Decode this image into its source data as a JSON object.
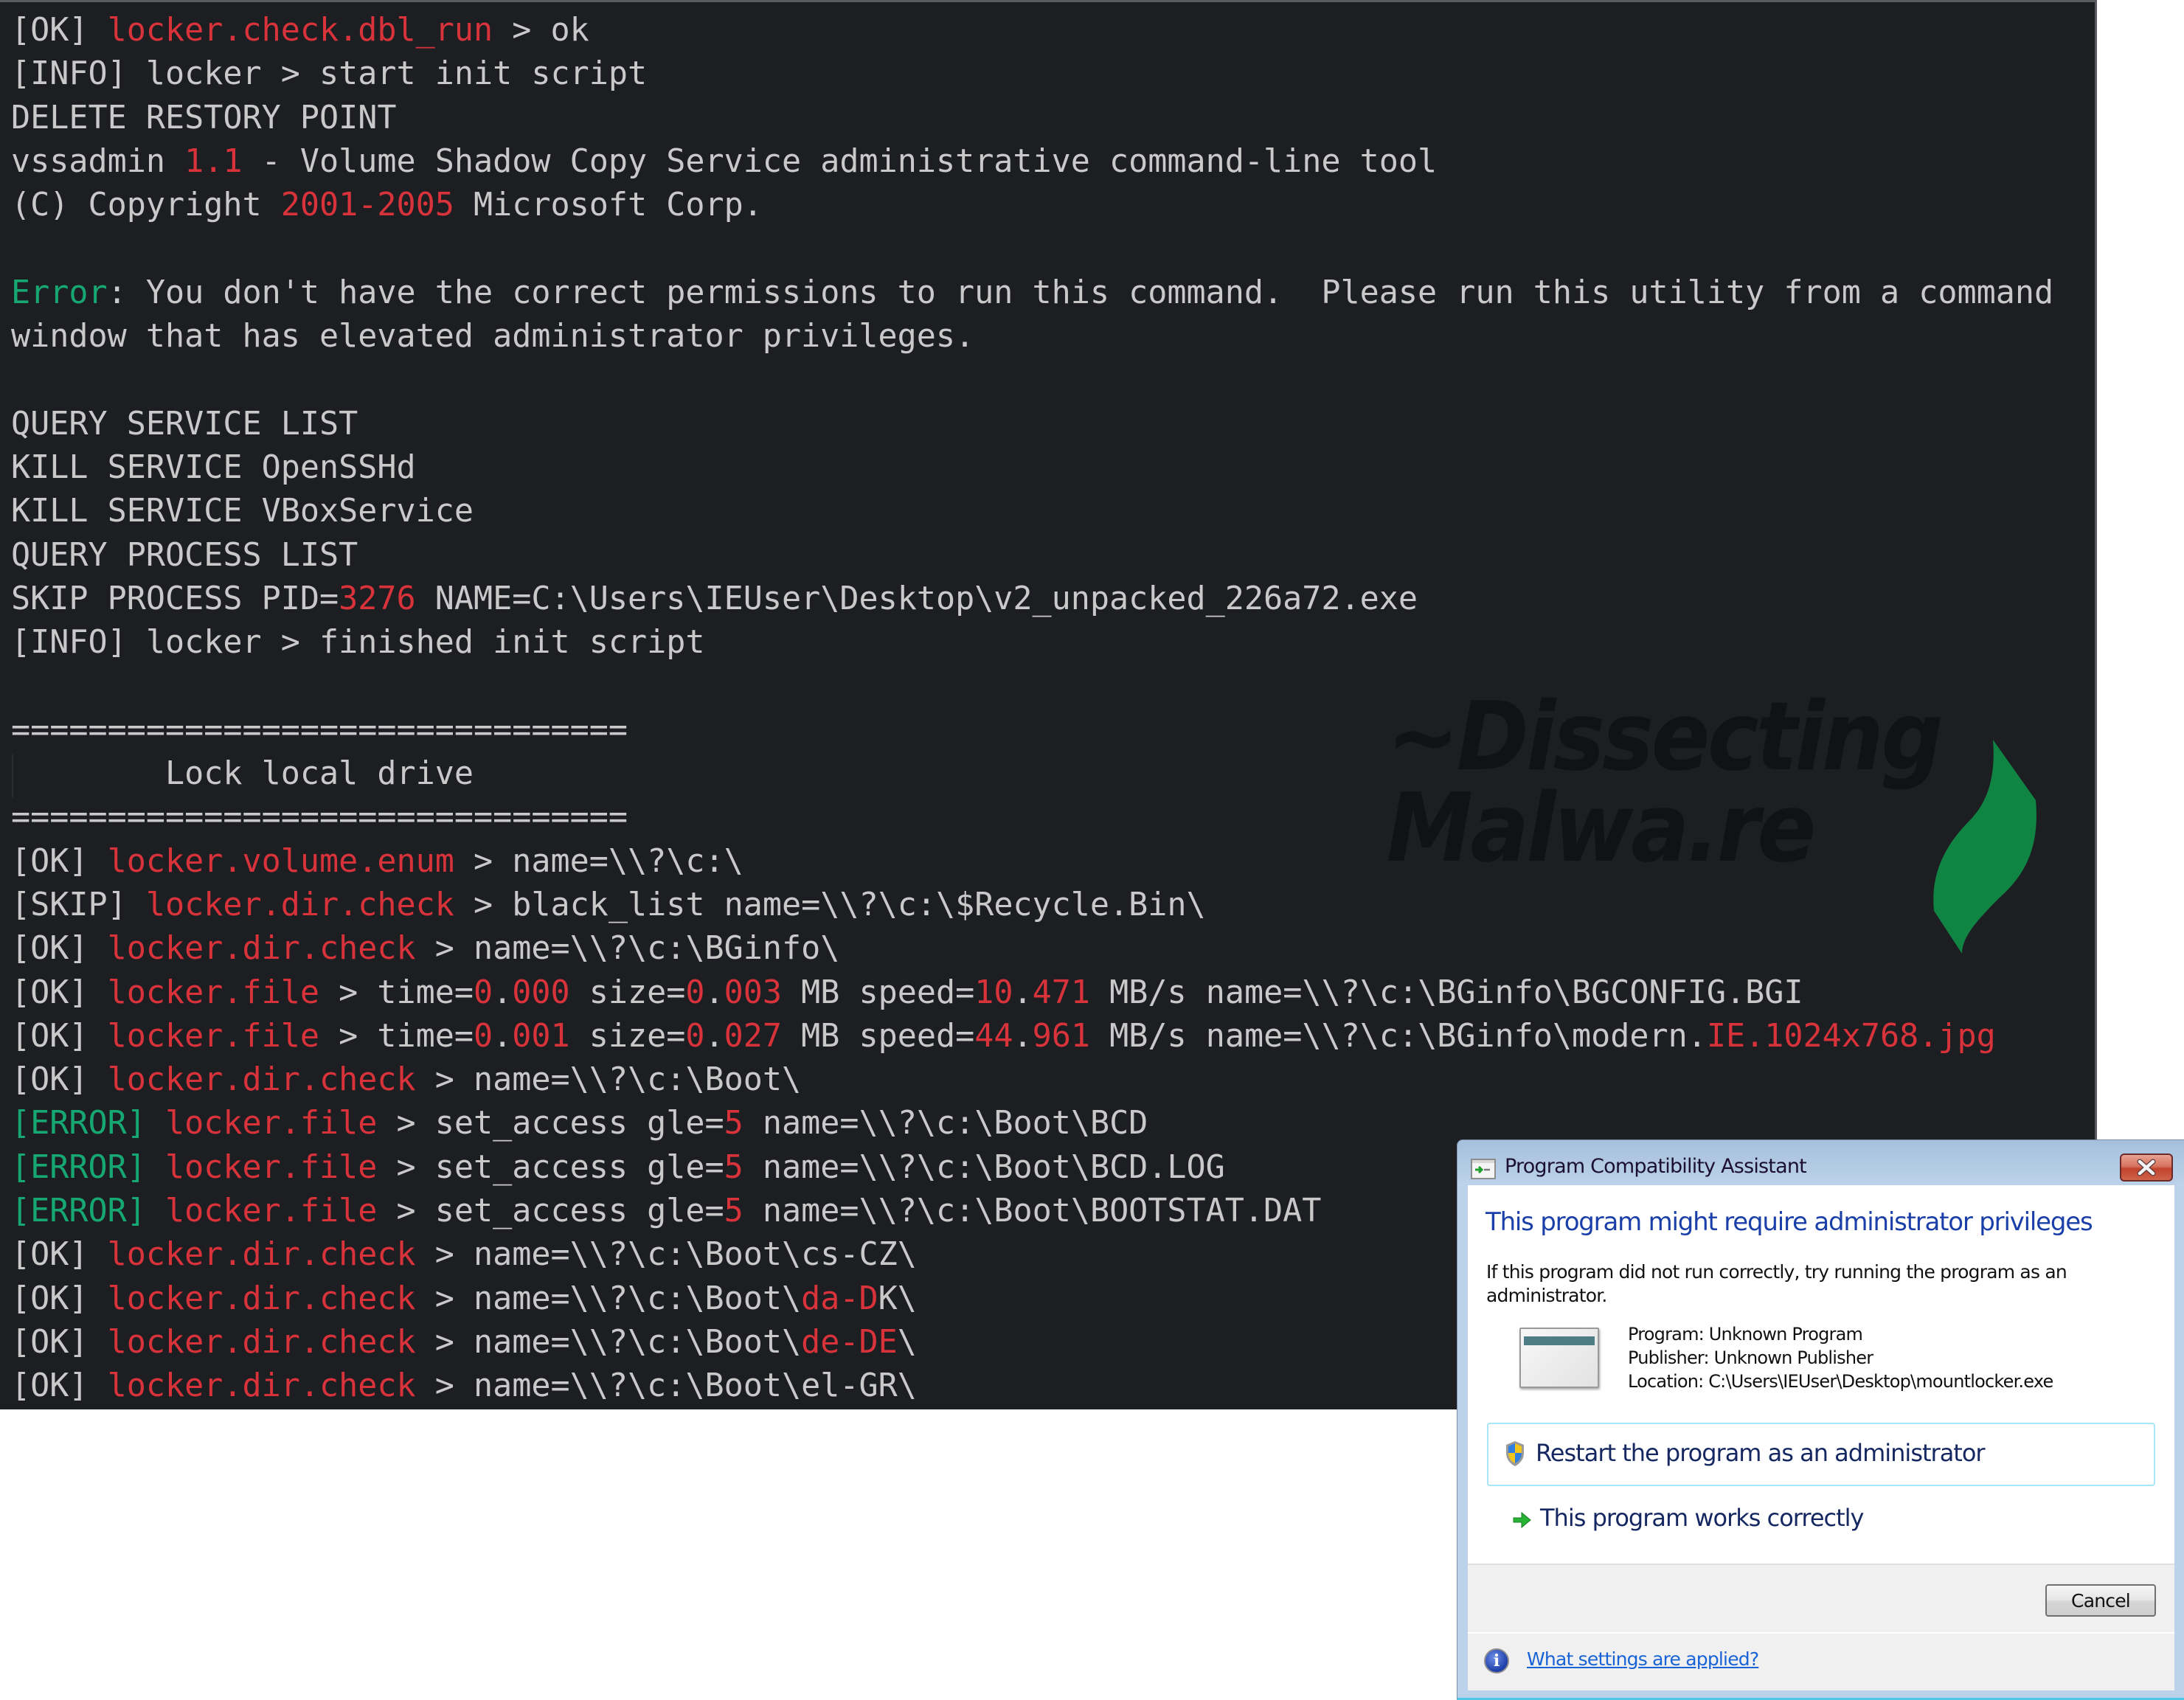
{
  "colors": {
    "terminal_bg": "#1d1e22",
    "text_default": "#c9c9c9",
    "text_red": "#d8323b",
    "text_green": "#16a772",
    "watermark_leaf": "#0f8443",
    "dialog_heading": "#1b3fa8",
    "link": "#1863d6"
  },
  "terminal": {
    "lines": [
      [
        [
          "gray",
          "[OK] "
        ],
        [
          "red",
          "locker.check.dbl_run"
        ],
        [
          "gray",
          " > ok"
        ]
      ],
      [
        [
          "gray",
          "[INFO] locker > start init script"
        ]
      ],
      [
        [
          "gray",
          "DELETE RESTORY POINT"
        ]
      ],
      [
        [
          "gray",
          "vssadmin "
        ],
        [
          "red",
          "1.1"
        ],
        [
          "gray",
          " - Volume Shadow Copy Service administrative command-line tool"
        ]
      ],
      [
        [
          "gray",
          "(C) Copyright "
        ],
        [
          "red",
          "2001-2005"
        ],
        [
          "gray",
          " Microsoft Corp."
        ]
      ],
      [],
      [
        [
          "green",
          "Error"
        ],
        [
          "gray",
          ": You don't have the correct permissions to run this command.  Please run this utility from a command"
        ]
      ],
      [
        [
          "gray",
          "window that has elevated administrator privileges."
        ]
      ],
      [],
      [
        [
          "gray",
          "QUERY SERVICE LIST"
        ]
      ],
      [
        [
          "gray",
          "KILL SERVICE OpenSSHd"
        ]
      ],
      [
        [
          "gray",
          "KILL SERVICE VBoxService"
        ]
      ],
      [
        [
          "gray",
          "QUERY PROCESS LIST"
        ]
      ],
      [
        [
          "gray",
          "SKIP PROCESS PID="
        ],
        [
          "red",
          "3276"
        ],
        [
          "gray",
          " NAME=C:\\Users\\IEUser\\Desktop\\v2_unpacked_226a72.exe"
        ]
      ],
      [
        [
          "gray",
          "[INFO] locker > finished init script"
        ]
      ],
      [],
      [
        [
          "gray",
          "================================"
        ]
      ],
      [
        [
          "gray",
          "        Lock local drive"
        ]
      ],
      [
        [
          "gray",
          "================================"
        ]
      ],
      [
        [
          "gray",
          "[OK] "
        ],
        [
          "red",
          "locker.volume.enum"
        ],
        [
          "gray",
          " > name=\\\\?\\c:\\"
        ]
      ],
      [
        [
          "gray",
          "[SKIP] "
        ],
        [
          "red",
          "locker.dir.check"
        ],
        [
          "gray",
          " > black_list name=\\\\?\\c:\\$Recycle.Bin\\"
        ]
      ],
      [
        [
          "gray",
          "[OK] "
        ],
        [
          "red",
          "locker.dir.check"
        ],
        [
          "gray",
          " > name=\\\\?\\c:\\BGinfo\\"
        ]
      ],
      [
        [
          "gray",
          "[OK] "
        ],
        [
          "red",
          "locker.file"
        ],
        [
          "gray",
          " > time="
        ],
        [
          "red",
          "0"
        ],
        [
          "gray",
          "."
        ],
        [
          "red",
          "000"
        ],
        [
          "gray",
          " size="
        ],
        [
          "red",
          "0"
        ],
        [
          "gray",
          "."
        ],
        [
          "red",
          "003"
        ],
        [
          "gray",
          " MB speed="
        ],
        [
          "red",
          "10"
        ],
        [
          "gray",
          "."
        ],
        [
          "red",
          "471"
        ],
        [
          "gray",
          " MB/s name=\\\\?\\c:\\BGinfo\\BGCONFIG.BGI"
        ]
      ],
      [
        [
          "gray",
          "[OK] "
        ],
        [
          "red",
          "locker.file"
        ],
        [
          "gray",
          " > time="
        ],
        [
          "red",
          "0"
        ],
        [
          "gray",
          "."
        ],
        [
          "red",
          "001"
        ],
        [
          "gray",
          " size="
        ],
        [
          "red",
          "0"
        ],
        [
          "gray",
          "."
        ],
        [
          "red",
          "027"
        ],
        [
          "gray",
          " MB speed="
        ],
        [
          "red",
          "44"
        ],
        [
          "gray",
          "."
        ],
        [
          "red",
          "961"
        ],
        [
          "gray",
          " MB/s name=\\\\?\\c:\\BGinfo\\modern."
        ],
        [
          "red",
          "IE.1024x768.jpg"
        ]
      ],
      [
        [
          "gray",
          "[OK] "
        ],
        [
          "red",
          "locker.dir.check"
        ],
        [
          "gray",
          " > name=\\\\?\\c:\\Boot\\"
        ]
      ],
      [
        [
          "green",
          "[ERROR]"
        ],
        [
          "gray",
          " "
        ],
        [
          "red",
          "locker.file"
        ],
        [
          "gray",
          " > set_access gle="
        ],
        [
          "red",
          "5"
        ],
        [
          "gray",
          " name=\\\\?\\c:\\Boot\\BCD"
        ]
      ],
      [
        [
          "green",
          "[ERROR]"
        ],
        [
          "gray",
          " "
        ],
        [
          "red",
          "locker.file"
        ],
        [
          "gray",
          " > set_access gle="
        ],
        [
          "red",
          "5"
        ],
        [
          "gray",
          " name=\\\\?\\c:\\Boot\\BCD.LOG"
        ]
      ],
      [
        [
          "green",
          "[ERROR]"
        ],
        [
          "gray",
          " "
        ],
        [
          "red",
          "locker.file"
        ],
        [
          "gray",
          " > set_access gle="
        ],
        [
          "red",
          "5"
        ],
        [
          "gray",
          " name=\\\\?\\c:\\Boot\\BOOTSTAT.DAT"
        ]
      ],
      [
        [
          "gray",
          "[OK] "
        ],
        [
          "red",
          "locker.dir.check"
        ],
        [
          "gray",
          " > name=\\\\?\\c:\\Boot\\cs-CZ\\"
        ]
      ],
      [
        [
          "gray",
          "[OK] "
        ],
        [
          "red",
          "locker.dir.check"
        ],
        [
          "gray",
          " > name=\\\\?\\c:\\Boot\\"
        ],
        [
          "red",
          "da-D"
        ],
        [
          "gray",
          "K\\"
        ]
      ],
      [
        [
          "gray",
          "[OK] "
        ],
        [
          "red",
          "locker.dir.check"
        ],
        [
          "gray",
          " > name=\\\\?\\c:\\Boot\\"
        ],
        [
          "red",
          "de-DE"
        ],
        [
          "gray",
          "\\"
        ]
      ],
      [
        [
          "gray",
          "[OK] "
        ],
        [
          "red",
          "locker.dir.check"
        ],
        [
          "gray",
          " > name=\\\\?\\c:\\Boot\\el-GR\\"
        ]
      ]
    ]
  },
  "watermark": {
    "line1": "~Dissecting",
    "line2": "Malwa.re",
    "icon": "leaf-logo-icon"
  },
  "dialog": {
    "title": "Program Compatibility Assistant",
    "title_icon": "program-compat-icon",
    "close_icon": "close-icon",
    "heading": "This program might require administrator privileges",
    "description": "If this program did not run correctly, try running the program as an administrator.",
    "program_icon": "application-window-icon",
    "program_label": "Program: Unknown Program",
    "publisher_label": "Publisher: Unknown Publisher",
    "location_label": "Location: C:\\Users\\IEUser\\Desktop\\mountlocker.exe",
    "restart_option": "Restart the program as an administrator",
    "restart_icon": "uac-shield-icon",
    "works_option": "This program works correctly",
    "works_icon": "green-arrow-icon",
    "cancel_label": "Cancel",
    "info_icon": "info-icon",
    "settings_link": "What settings are applied?"
  }
}
